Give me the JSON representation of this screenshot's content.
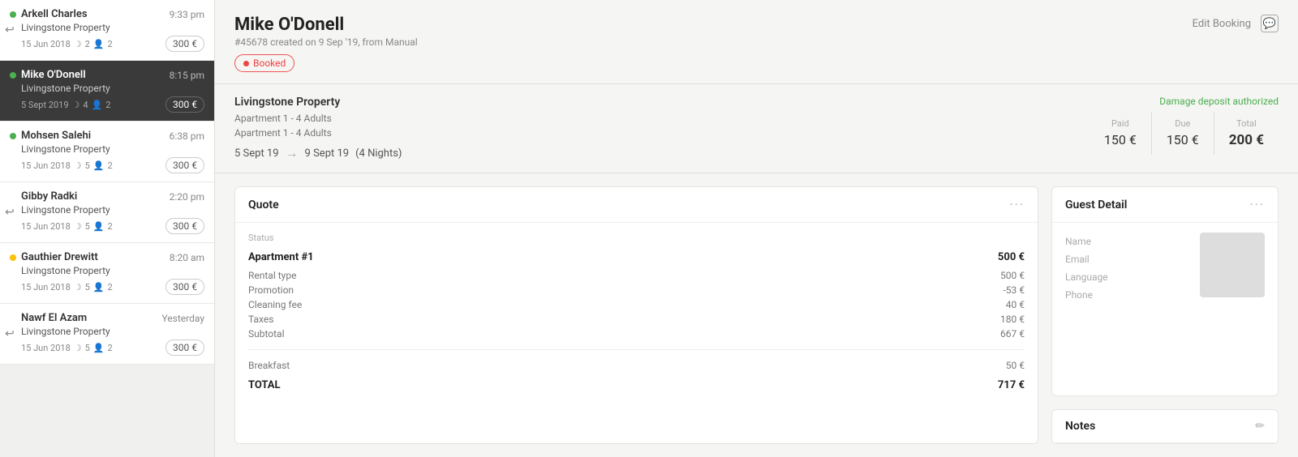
{
  "sidebar": {
    "bookings": [
      {
        "id": 1,
        "name": "Arkell Charles",
        "time": "9:33 pm",
        "property": "Livingstone Property",
        "date": "15 Jun 2018",
        "nights": 2,
        "persons": 2,
        "price": "300 €",
        "active": false,
        "has_return": true,
        "dot_color": "green"
      },
      {
        "id": 2,
        "name": "Mike O'Donell",
        "time": "8:15 pm",
        "property": "Livingstone Property",
        "date": "5 Sept 2019",
        "nights": 4,
        "persons": 2,
        "price": "300 €",
        "active": true,
        "has_return": false,
        "dot_color": "green"
      },
      {
        "id": 3,
        "name": "Mohsen Salehi",
        "time": "6:38 pm",
        "property": "Livingstone Property",
        "date": "15 Jun 2018",
        "nights": 5,
        "persons": 2,
        "price": "300 €",
        "active": false,
        "has_return": false,
        "dot_color": "green"
      },
      {
        "id": 4,
        "name": "Gibby Radki",
        "time": "2:20 pm",
        "property": "Livingstone Property",
        "date": "15 Jun 2018",
        "nights": 5,
        "persons": 2,
        "price": "300 €",
        "active": false,
        "has_return": true,
        "dot_color": "none"
      },
      {
        "id": 5,
        "name": "Gauthier Drewitt",
        "time": "8:20 am",
        "property": "Livingstone Property",
        "date": "15 Jun 2018",
        "nights": 5,
        "persons": 2,
        "price": "300 €",
        "active": false,
        "has_return": false,
        "dot_color": "yellow"
      },
      {
        "id": 6,
        "name": "Nawf El Azam",
        "time": "Yesterday",
        "property": "Livingstone Property",
        "date": "15 Jun 2018",
        "nights": 5,
        "persons": 2,
        "price": "300 €",
        "active": false,
        "has_return": true,
        "dot_color": "none"
      }
    ]
  },
  "booking": {
    "guest_name": "Mike O'Donell",
    "subtitle": "#45678 created on 9 Sep '19, from Manual",
    "status": "Booked",
    "edit_label": "Edit Booking",
    "property_name": "Livingstone Property",
    "room_line1": "Apartment 1 - 4 Adults",
    "room_line2": "Apartment 1 - 4 Adults",
    "date_from": "5 Sept 19",
    "date_to": "9 Sept 19",
    "nights_label": "(4 Nights)",
    "damage_deposit": "Damage deposit authorized",
    "paid_label": "Paid",
    "paid_amount": "150 €",
    "due_label": "Due",
    "due_amount": "150 €",
    "total_label": "Total",
    "total_amount": "200 €"
  },
  "quote": {
    "title": "Quote",
    "status_label": "Status",
    "section_title": "Apartment #1",
    "section_amount": "500 €",
    "rows": [
      {
        "label": "Rental type",
        "value": "500 €"
      },
      {
        "label": "Promotion",
        "value": "-53 €"
      },
      {
        "label": "Cleaning fee",
        "value": "40 €"
      },
      {
        "label": "Taxes",
        "value": "180 €"
      },
      {
        "label": "Subtotal",
        "value": "667 €"
      }
    ],
    "breakfast_label": "Breakfast",
    "breakfast_value": "50 €",
    "total_label": "TOTAL",
    "total_value": "717 €"
  },
  "guest_detail": {
    "title": "Guest Detail",
    "name_label": "Name",
    "email_label": "Email",
    "language_label": "Language",
    "phone_label": "Phone"
  },
  "notes": {
    "title": "Notes"
  }
}
